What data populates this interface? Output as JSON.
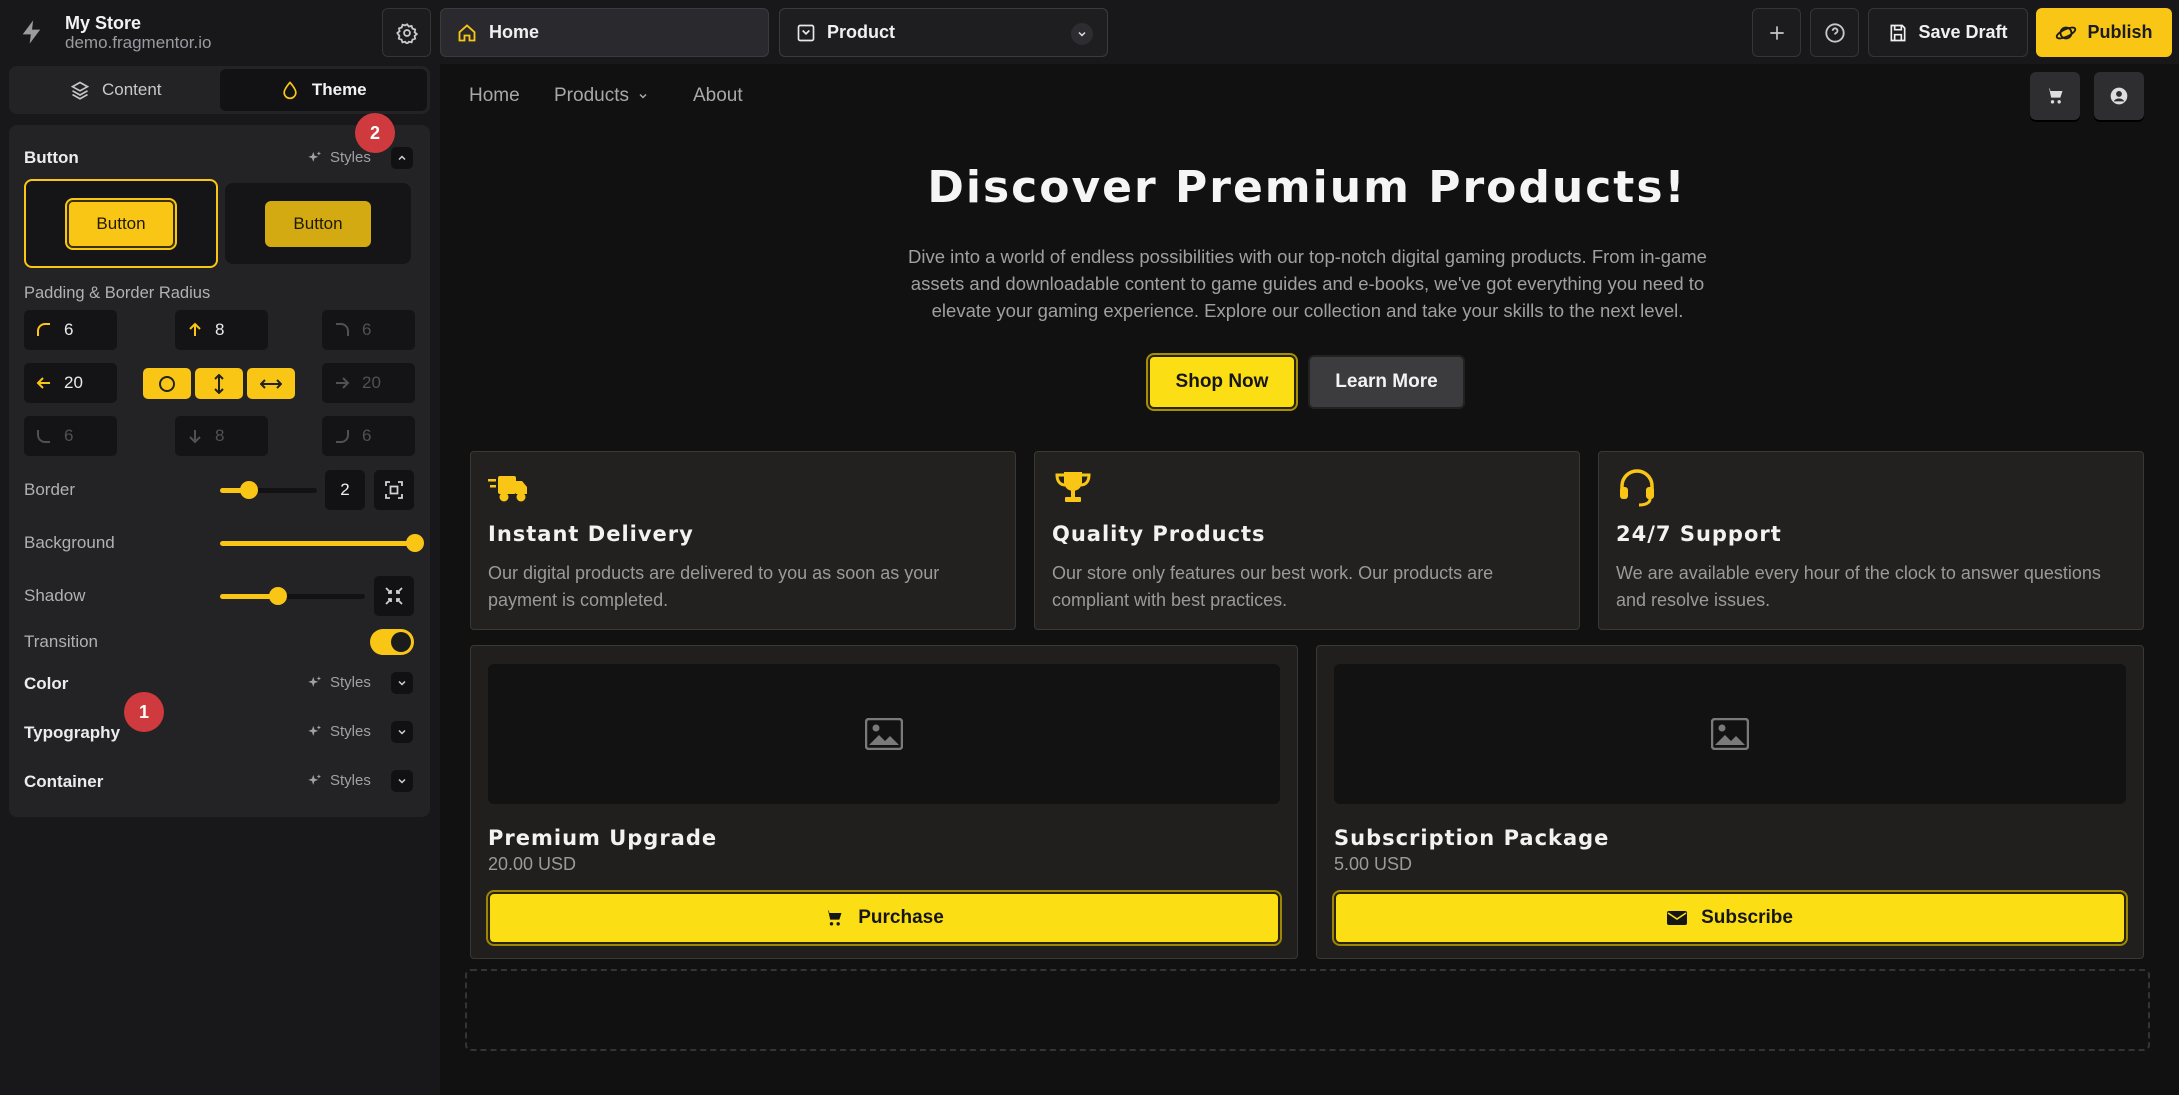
{
  "brand": {
    "name": "My Store",
    "domain": "demo.fragmentor.io"
  },
  "topbar": {
    "page_select": {
      "label": "Home"
    },
    "template_select": {
      "label": "Product"
    },
    "save_draft_label": "Save Draft",
    "publish_label": "Publish"
  },
  "sidebar": {
    "tabs": [
      {
        "label": "Content",
        "active": false
      },
      {
        "label": "Theme",
        "active": true
      }
    ],
    "button_section": {
      "title": "Button",
      "styles_label": "Styles",
      "variants": [
        {
          "label": "Button",
          "selected": true
        },
        {
          "label": "Button",
          "selected": false
        }
      ],
      "padding_label": "Padding & Border Radius",
      "padding": {
        "top_left_radius": "6",
        "top": "8",
        "top_right_radius": "6",
        "left": "20",
        "right": "20",
        "bottom_left_radius": "6",
        "bottom": "8",
        "bottom_right_radius": "6"
      },
      "border": {
        "label": "Border",
        "value": "2",
        "level": 0.3
      },
      "background": {
        "label": "Background",
        "level": 1.0
      },
      "shadow": {
        "label": "Shadow",
        "level": 0.4
      },
      "transition": {
        "label": "Transition",
        "on": true
      }
    },
    "collapsed_sections": [
      {
        "title": "Color",
        "styles_label": "Styles"
      },
      {
        "title": "Typography",
        "styles_label": "Styles"
      },
      {
        "title": "Container",
        "styles_label": "Styles"
      }
    ],
    "badges": [
      "1",
      "2"
    ]
  },
  "colors": {
    "accent": "#fac616",
    "button_yellow": "#fbdf14"
  },
  "preview": {
    "nav": [
      {
        "label": "Home"
      },
      {
        "label": "Products"
      },
      {
        "label": "About"
      }
    ],
    "hero": {
      "title": "Discover Premium Products!",
      "body": "Dive into a world of endless possibilities with our top-notch digital gaming products. From in-game assets and downloadable content to game guides and e-books, we've got everything you need to elevate your gaming experience. Explore our collection and take your skills to the next level.",
      "primary_cta": "Shop Now",
      "secondary_cta": "Learn More"
    },
    "features": [
      {
        "icon": "truck-fast-icon",
        "title": "Instant Delivery",
        "body": "Our digital products are delivered to you as soon as your payment is completed."
      },
      {
        "icon": "trophy-icon",
        "title": "Quality Products",
        "body": "Our store only features our best work. Our products are compliant with best practices."
      },
      {
        "icon": "headset-icon",
        "title": "24/7 Support",
        "body": "We are available every hour of the clock to answer questions and resolve issues."
      }
    ],
    "products": [
      {
        "title": "Premium Upgrade",
        "price": "20.00 USD",
        "button": "Purchase",
        "button_icon": "cart-icon"
      },
      {
        "title": "Subscription Package",
        "price": "5.00 USD",
        "button": "Subscribe",
        "button_icon": "envelope-icon"
      }
    ]
  }
}
